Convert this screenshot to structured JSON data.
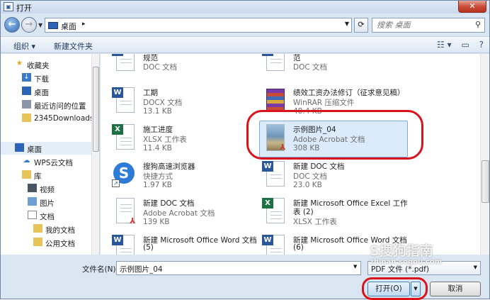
{
  "window": {
    "title": "打开",
    "close": "✕"
  },
  "address": {
    "crumb": "桌面",
    "arrow": "▸",
    "dropdown": "▾"
  },
  "search": {
    "placeholder": "搜索 桌面"
  },
  "toolbar": {
    "organize": "组织 ▾",
    "new_folder": "新建文件夹"
  },
  "sidebar": {
    "items": [
      {
        "label": "收藏夹",
        "icon": "star-icon"
      },
      {
        "label": "下载",
        "icon": "download-icon"
      },
      {
        "label": "桌面",
        "icon": "desktop-icon"
      },
      {
        "label": "最近访问的位置",
        "icon": "recent-icon"
      },
      {
        "label": "2345Downloads",
        "icon": "folder-icon"
      },
      {
        "label": "桌面",
        "icon": "desktop-icon"
      },
      {
        "label": "WPS云文档",
        "icon": "cloud-icon"
      },
      {
        "label": "库",
        "icon": "library-icon"
      },
      {
        "label": "视频",
        "icon": "video-icon"
      },
      {
        "label": "图片",
        "icon": "picture-icon"
      },
      {
        "label": "文档",
        "icon": "document-icon"
      },
      {
        "label": "我的文档",
        "icon": "folder-icon"
      },
      {
        "label": "公用文档",
        "icon": "folder-icon"
      }
    ]
  },
  "files": [
    {
      "name": "规范",
      "type": "DOC 文档",
      "size": ""
    },
    {
      "name": "范",
      "type": "DOC 文档",
      "size": ""
    },
    {
      "name": "工期",
      "type": "DOCX 文档",
      "size": "13.1 KB"
    },
    {
      "name": "绩效工资办法修订（征求意见稿）",
      "type": "WinRAR 压缩文件",
      "size": "48.4 KB"
    },
    {
      "name": "施工进度",
      "type": "XLSX 工作表",
      "size": "11.4 KB"
    },
    {
      "name": "示例图片_04",
      "type": "Adobe Acrobat 文档",
      "size": "308 KB"
    },
    {
      "name": "搜狗高速浏览器",
      "type": "快捷方式",
      "size": "1.97 KB"
    },
    {
      "name": "新建 DOC 文档",
      "type": "DOC 文档",
      "size": "23.0 KB"
    },
    {
      "name": "新建 DOC 文档",
      "type": "Adobe Acrobat 文档",
      "size": "139 KB"
    },
    {
      "name": "新建 Microsoft Office Excel 工作",
      "name2": "表 (2)",
      "type": "XLSX 工作表",
      "size": ""
    },
    {
      "name": "新建 Microsoft Office Word 文档",
      "name2": "(5)",
      "type": "",
      "size": ""
    },
    {
      "name": "新建 Microsoft Office Word 文档",
      "name2": "(6)",
      "type": "",
      "size": ""
    }
  ],
  "bottom": {
    "filename_label": "文件名(N):",
    "filename_value": "示例图片_04",
    "filetype": "PDF 文件 (*.pdf)",
    "open": "打开(O)",
    "cancel": "取消"
  },
  "watermark": {
    "text": "S搜狗指南",
    "url": "zhinan.sogou.com"
  },
  "colors": {
    "accent": "#2b579a",
    "highlight": "#d9131c",
    "selection": "#dcebfc"
  }
}
